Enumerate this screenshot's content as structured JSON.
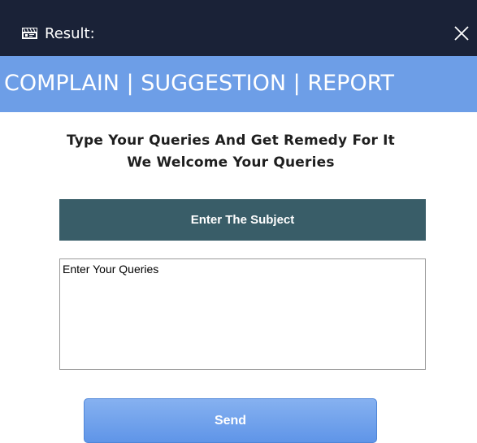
{
  "window": {
    "title": "Result:",
    "icon": "film-clapper-icon",
    "close_icon": "close-icon"
  },
  "header": {
    "text": "COMPLAIN | SUGGESTION | REPORT"
  },
  "intro": {
    "line1": "Type Your Queries And Get Remedy For It",
    "line2": "We Welcome Your Queries"
  },
  "subject": {
    "label": "Enter The Subject"
  },
  "queries": {
    "text": "Enter Your Queries"
  },
  "send": {
    "label": "Send"
  },
  "colors": {
    "titlebar": "#1a2237",
    "header_band": "#6d9ee7",
    "subject_bar": "#395d68",
    "send_button": "#6d9ee7"
  }
}
